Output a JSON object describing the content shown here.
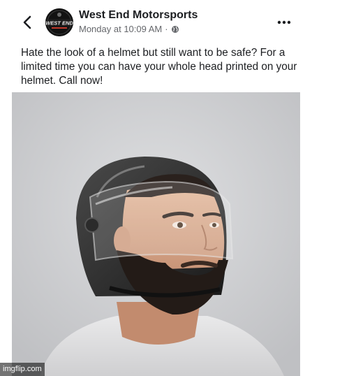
{
  "post": {
    "page_name": "West End Motorsports",
    "timestamp": "Monday at 10:09 AM",
    "separator": "·",
    "privacy_icon": "globe-icon",
    "text": "Hate the look of a helmet but still want to be safe? For a limited time you can have your whole head printed on your helmet. Call now!",
    "avatar_logo_text": "WEST END"
  },
  "header": {
    "back_icon": "chevron-left-icon",
    "more_icon": "more-dots-icon"
  },
  "watermark": {
    "text": "imgflip.com"
  },
  "colors": {
    "name": "#1c1e21",
    "meta": "#65676b",
    "photo_bg": "#d5d5d7"
  }
}
